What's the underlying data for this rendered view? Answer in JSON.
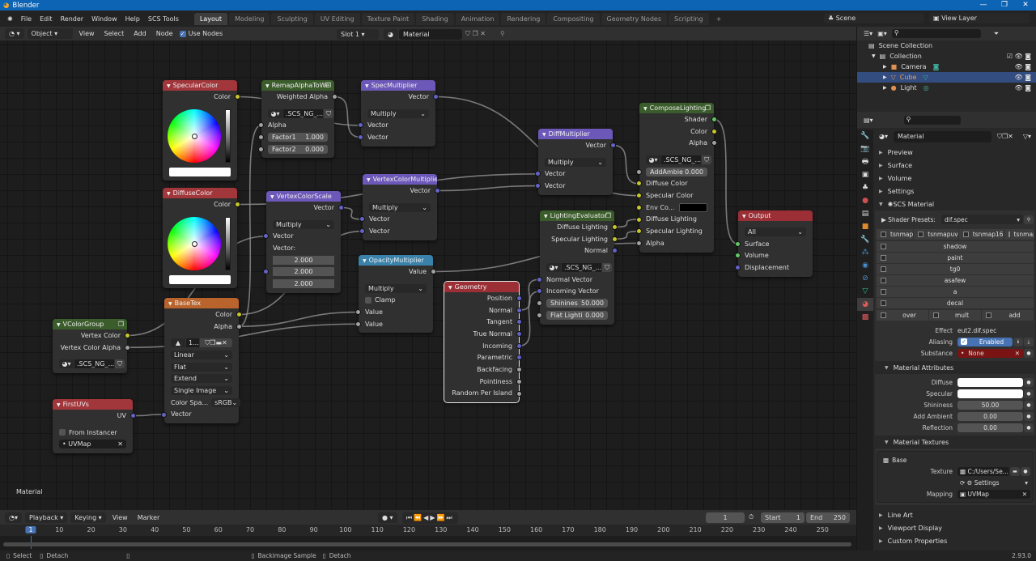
{
  "window": {
    "title": "Blender"
  },
  "menu": [
    "File",
    "Edit",
    "Render",
    "Window",
    "Help",
    "SCS Tools"
  ],
  "workspaces": [
    "Layout",
    "Modeling",
    "Sculpting",
    "UV Editing",
    "Texture Paint",
    "Shading",
    "Animation",
    "Rendering",
    "Compositing",
    "Geometry Nodes",
    "Scripting",
    "+"
  ],
  "scene": {
    "scene": "Scene",
    "view_layer": "View Layer"
  },
  "node_header": {
    "mode": "Object",
    "view": "View",
    "select": "Select",
    "add": "Add",
    "node": "Node",
    "use_nodes": "Use Nodes",
    "slot": "Slot 1",
    "material": "Material"
  },
  "editor_label": "Material",
  "nodes": [
    {
      "title": "SpecularColor",
      "color": "#a1363b",
      "outputs": [
        {
          "label": "Color",
          "socket": "#c7c729"
        }
      ],
      "props": [
        {
          "color_wheel": true
        },
        {
          "swatch": "#ffffff"
        }
      ],
      "inputs": []
    },
    {
      "title": "RemapAlphaToWe",
      "color": "#3b5c2b",
      "group_icon": true,
      "outputs": [
        {
          "label": "Weighted Alpha",
          "socket": "#a1a1a1"
        }
      ],
      "props": [
        {
          "group": ".SCS_NG_..."
        }
      ],
      "inputs": [
        {
          "label": "Alpha",
          "socket": "#a1a1a1"
        },
        {
          "label": "Factor1",
          "value": "1.000",
          "socket": "#a1a1a1"
        },
        {
          "label": "Factor2",
          "value": "0.000",
          "socket": "#a1a1a1"
        }
      ]
    },
    {
      "title": "SpecMultiplier",
      "color": "#6b58b8",
      "outputs": [
        {
          "label": "Vector",
          "socket": "#6363c7"
        }
      ],
      "props": [
        {
          "select": "Multiply"
        }
      ],
      "inputs": [
        {
          "label": "Vector",
          "socket": "#6363c7"
        },
        {
          "label": "Vector",
          "socket": "#6363c7"
        }
      ]
    },
    {
      "title": "DiffMultiplier",
      "color": "#6b58b8",
      "outputs": [
        {
          "label": "Vector",
          "socket": "#6363c7"
        }
      ],
      "props": [
        {
          "select": "Multiply"
        }
      ],
      "inputs": [
        {
          "label": "Vector",
          "socket": "#6363c7"
        },
        {
          "label": "Vector",
          "socket": "#6363c7"
        }
      ]
    },
    {
      "title": "ComposeLighting",
      "color": "#3b5c2b",
      "group_icon": true,
      "outputs": [
        {
          "label": "Shader",
          "socket": "#63c763"
        },
        {
          "label": "Color",
          "socket": "#c7c729"
        },
        {
          "label": "Alpha",
          "socket": "#a1a1a1"
        }
      ],
      "props": [
        {
          "group": ".SCS_NG_..."
        }
      ],
      "inputs": [
        {
          "label": "AddAmbie",
          "value": "0.000",
          "socket": "#a1a1a1"
        },
        {
          "label": "Diffuse Color",
          "socket": "#c7c729"
        },
        {
          "label": "Specular Color",
          "socket": "#c7c729"
        },
        {
          "label": "Env Co...",
          "swatch": "#000000",
          "socket": "#c7c729"
        },
        {
          "label": "Diffuse Lighting",
          "socket": "#c7c729"
        },
        {
          "label": "Specular Lighting",
          "socket": "#c7c729"
        },
        {
          "label": "Alpha",
          "socket": "#a1a1a1"
        }
      ]
    },
    {
      "title": "Output",
      "color": "#9c2f35",
      "outputs": [],
      "props": [
        {
          "select": "All"
        }
      ],
      "inputs": [
        {
          "label": "Surface",
          "socket": "#63c763"
        },
        {
          "label": "Volume",
          "socket": "#63c763"
        },
        {
          "label": "Displacement",
          "socket": "#6363c7"
        }
      ]
    },
    {
      "title": "DiffuseColor",
      "color": "#a1363b",
      "outputs": [
        {
          "label": "Color",
          "socket": "#c7c729"
        }
      ],
      "props": [
        {
          "color_wheel": true
        },
        {
          "swatch": "#ffffff"
        }
      ],
      "inputs": []
    },
    {
      "title": "VertexColorScale",
      "color": "#6b58b8",
      "outputs": [
        {
          "label": "Vector",
          "socket": "#6363c7"
        }
      ],
      "props": [
        {
          "select": "Multiply"
        }
      ],
      "inputs": [
        {
          "label": "Vector",
          "socket": "#6363c7"
        },
        {
          "label": "Vector:",
          "values": [
            "2.000",
            "2.000",
            "2.000"
          ],
          "socket": "#6363c7"
        }
      ]
    },
    {
      "title": "VertexColorMultiplier",
      "color": "#6b58b8",
      "outputs": [
        {
          "label": "Vector",
          "socket": "#6363c7"
        }
      ],
      "props": [
        {
          "select": "Multiply"
        }
      ],
      "inputs": [
        {
          "label": "Vector",
          "socket": "#6363c7"
        },
        {
          "label": "Vector",
          "socket": "#6363c7"
        }
      ]
    },
    {
      "title": "OpacityMultiplier",
      "color": "#3a82ab",
      "outputs": [
        {
          "label": "Value",
          "socket": "#a1a1a1"
        }
      ],
      "props": [
        {
          "select": "Multiply"
        },
        {
          "checkbox": "Clamp",
          "checked": false
        }
      ],
      "inputs": [
        {
          "label": "Value",
          "socket": "#a1a1a1"
        },
        {
          "label": "Value",
          "socket": "#a1a1a1"
        }
      ]
    },
    {
      "title": "Geometry",
      "color": "#9c2f35",
      "selected": true,
      "outputs": [
        {
          "label": "Position",
          "socket": "#6363c7"
        },
        {
          "label": "Normal",
          "socket": "#6363c7"
        },
        {
          "label": "Tangent",
          "socket": "#6363c7"
        },
        {
          "label": "True Normal",
          "socket": "#6363c7"
        },
        {
          "label": "Incoming",
          "socket": "#6363c7"
        },
        {
          "label": "Parametric",
          "socket": "#6363c7"
        },
        {
          "label": "Backfacing",
          "socket": "#a1a1a1"
        },
        {
          "label": "Pointiness",
          "socket": "#a1a1a1"
        },
        {
          "label": "Random Per Island",
          "socket": "#a1a1a1"
        }
      ],
      "props": [],
      "inputs": []
    },
    {
      "title": "LightingEvaluator",
      "color": "#3b5c2b",
      "group_icon": true,
      "outputs": [
        {
          "label": "Diffuse Lighting",
          "socket": "#c7c729"
        },
        {
          "label": "Specular Lighting",
          "socket": "#c7c729"
        },
        {
          "label": "Normal",
          "socket": "#6363c7"
        }
      ],
      "props": [
        {
          "group": ".SCS_NG_..."
        }
      ],
      "inputs": [
        {
          "label": "Normal Vector",
          "socket": "#6363c7"
        },
        {
          "label": "Incoming Vector",
          "socket": "#6363c7"
        },
        {
          "label": "Shinines",
          "value": "50.000",
          "socket": "#a1a1a1"
        },
        {
          "label": "Flat Lighti",
          "value": "0.000",
          "socket": "#a1a1a1"
        }
      ]
    },
    {
      "title": "BaseTex",
      "color": "#b9642c",
      "outputs": [
        {
          "label": "Color",
          "socket": "#c7c729"
        },
        {
          "label": "Alpha",
          "socket": "#a1a1a1"
        }
      ],
      "props": [
        {
          "image": "1..."
        },
        {
          "select": "Linear"
        },
        {
          "select": "Flat"
        },
        {
          "select": "Extend"
        },
        {
          "select": "Single Image"
        },
        {
          "label": "Color Spa...",
          "select": "sRGB"
        }
      ],
      "inputs": [
        {
          "label": "Vector",
          "socket": "#6363c7"
        }
      ]
    },
    {
      "title": "VColorGroup",
      "color": "#3b5c2b",
      "group_icon": true,
      "outputs": [
        {
          "label": "Vertex Color",
          "socket": "#c7c729"
        },
        {
          "label": "Vertex Color Alpha",
          "socket": "#a1a1a1"
        }
      ],
      "props": [
        {
          "group": ".SCS_NG_..."
        }
      ],
      "inputs": []
    },
    {
      "title": "FirstUVs",
      "color": "#a1363b",
      "outputs": [
        {
          "label": "UV",
          "socket": "#6363c7"
        }
      ],
      "props": [
        {
          "checkbox": "From Instancer",
          "checked": false
        },
        {
          "uvmap": "UVMap"
        }
      ],
      "inputs": []
    }
  ],
  "outliner": {
    "items": [
      {
        "label": "Scene Collection"
      },
      {
        "label": "Collection"
      },
      {
        "label": "Camera"
      },
      {
        "label": "Cube",
        "selected": true
      },
      {
        "label": "Light"
      }
    ]
  },
  "properties": {
    "material_name": "Material",
    "sections": [
      "Preview",
      "Surface",
      "Volume",
      "Settings"
    ],
    "scs_material": "SCS Material",
    "shader_presets_label": "Shader Presets:",
    "shader_preset": "dif.spec",
    "flags_top": [
      "tsnmap",
      "tsnmapuv",
      "tsnmap16",
      "tsnmapu..."
    ],
    "flags": [
      "shadow",
      "paint",
      "tg0",
      "asafew",
      "a",
      "decal"
    ],
    "flags_bottom": [
      "over",
      "mult",
      "add"
    ],
    "effect_label": "Effect",
    "effect": "eut2.dif.spec",
    "aliasing_label": "Aliasing",
    "aliasing": "Enabled",
    "substance_label": "Substance",
    "substance": "None",
    "attributes_title": "Material Attributes",
    "attributes": [
      {
        "label": "Diffuse",
        "color": "#ffffff"
      },
      {
        "label": "Specular",
        "color": "#ffffff"
      },
      {
        "label": "Shininess",
        "value": "50.00"
      },
      {
        "label": "Add Ambient",
        "value": "0.00"
      },
      {
        "label": "Reflection",
        "value": "0.00"
      }
    ],
    "textures_title": "Material Textures",
    "texture_name": "Base",
    "texture_label": "Texture",
    "texture_path": "C:/Users/Se...",
    "settings": "Settings",
    "mapping_label": "Mapping",
    "mapping": "UVMap",
    "bottom_sections": [
      "Line Art",
      "Viewport Display",
      "Custom Properties"
    ]
  },
  "timeline": {
    "menus": [
      "Playback",
      "Keying",
      "View",
      "Marker"
    ],
    "current_frame": "1",
    "start_label": "Start",
    "start": "1",
    "end_label": "End",
    "end": "250",
    "ticks": [
      "10",
      "20",
      "30",
      "40",
      "50",
      "60",
      "70",
      "80",
      "90",
      "100",
      "110",
      "120",
      "130",
      "140",
      "150",
      "160",
      "170",
      "180",
      "190",
      "200",
      "210",
      "220",
      "230",
      "240",
      "250"
    ]
  },
  "status": {
    "select": "Select",
    "detach": "Detach",
    "backimage": "Backimage Sample",
    "detach2": "Detach",
    "version": "2.93.0"
  }
}
